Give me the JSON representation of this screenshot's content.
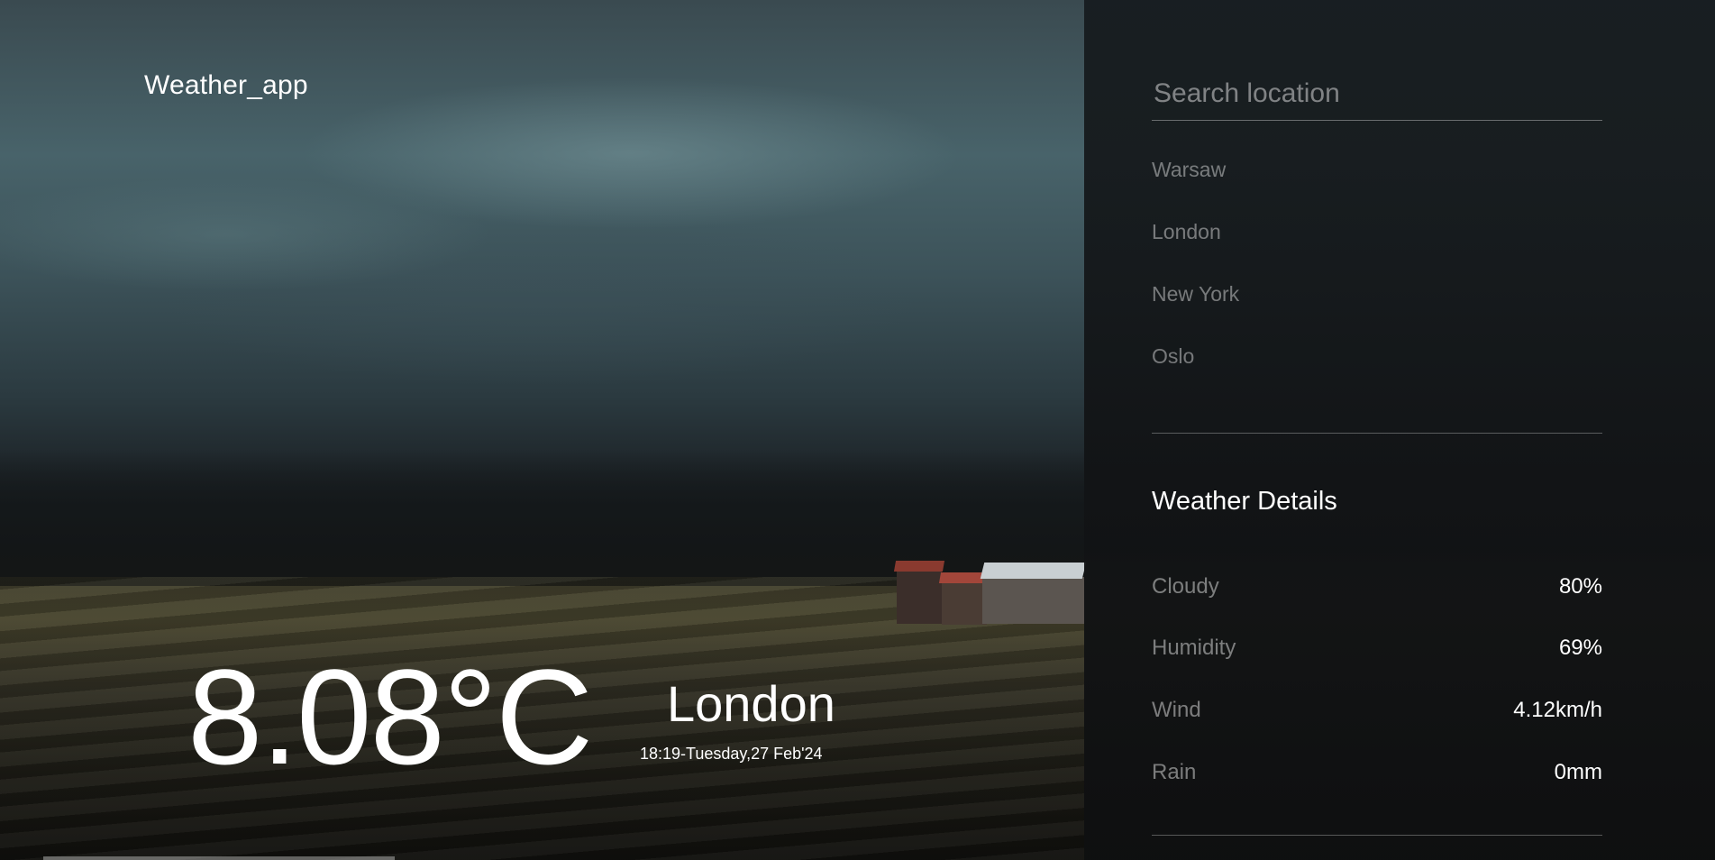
{
  "app": {
    "title": "Weather_app"
  },
  "current": {
    "temperature": "8.08°C",
    "city": "London",
    "datetime": "18:19-Tuesday,27 Feb'24"
  },
  "search": {
    "placeholder": "Search location",
    "value": ""
  },
  "locations": [
    "Warsaw",
    "London",
    "New York",
    "Oslo"
  ],
  "details": {
    "heading": "Weather Details",
    "rows": [
      {
        "label": "Cloudy",
        "value": "80%"
      },
      {
        "label": "Humidity",
        "value": "69%"
      },
      {
        "label": "Wind",
        "value": "4.12km/h"
      },
      {
        "label": "Rain",
        "value": "0mm"
      }
    ]
  }
}
